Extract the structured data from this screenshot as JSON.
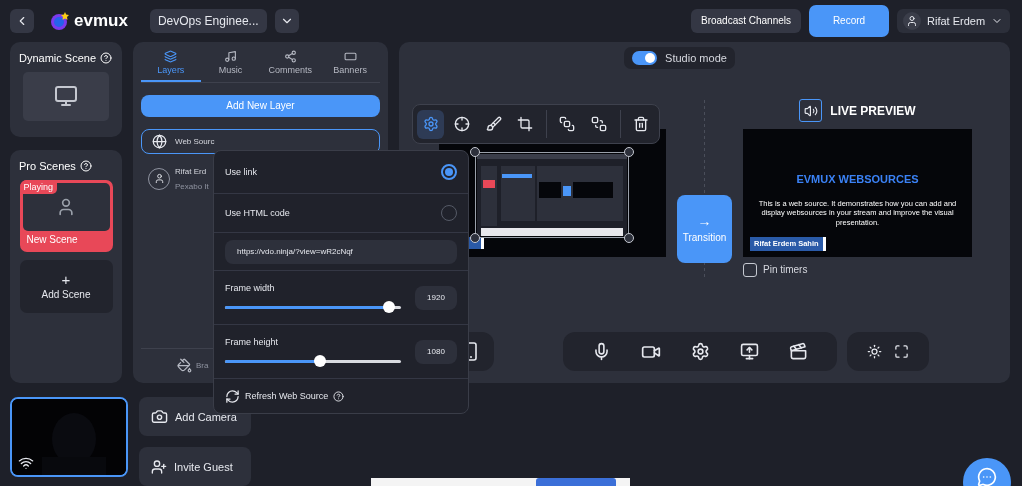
{
  "header": {
    "brand": "evmux",
    "project": "DevOps Enginee...",
    "buttons": [
      {
        "label": "Broadcast Channels",
        "kind": "secondary"
      },
      {
        "label": "Record",
        "kind": "primary"
      }
    ],
    "user": "Rifat Erdem"
  },
  "dynamic_scene": {
    "title": "Dynamic Scene"
  },
  "pro_scenes": {
    "title": "Pro Scenes",
    "scenes": [
      {
        "name": "New Scene",
        "badge": "Playing",
        "selected": true
      }
    ],
    "add_label": "Add Scene",
    "add_symbol": "+"
  },
  "layers_panel": {
    "tabs": [
      {
        "label": "Layers",
        "kind": "layers",
        "selected": true
      },
      {
        "label": "Music",
        "kind": "music",
        "selected": false
      },
      {
        "label": "Comments",
        "kind": "comments",
        "selected": false
      },
      {
        "label": "Banners",
        "kind": "banners",
        "selected": false
      }
    ],
    "add_button": "Add New Layer",
    "layers": [
      {
        "name": "Web Sourc",
        "kind": "web",
        "selected": true
      },
      {
        "name": "Rifat Erd",
        "subtitle": "Pexabo It",
        "kind": "person",
        "selected": false
      }
    ],
    "footer": "Bra"
  },
  "source_popup": {
    "options": [
      {
        "label": "Use link",
        "selected": true
      },
      {
        "label": "Use HTML code",
        "selected": false
      }
    ],
    "url": "https://vdo.ninja/?view=wR2cNqf",
    "sliders": [
      {
        "label": "Frame width",
        "level": 0.93,
        "value": "1920"
      },
      {
        "label": "Frame height",
        "level": 0.54,
        "value": "1080"
      }
    ],
    "refresh": "Refresh Web Source"
  },
  "stage": {
    "studio_mode": {
      "label": "Studio mode",
      "on": true
    },
    "transition": {
      "arrow": "→",
      "label": "Transition"
    },
    "live_preview": {
      "title": "LIVE PREVIEW",
      "headline": "EVMUX WEBSOURCES",
      "text": "This is a web source. It demonstrates how you can add and display websources in your stream and improve the visual presentation.",
      "name_tag": "Rifat Erdem Sahin"
    },
    "pin_timers": {
      "label": "Pin timers",
      "checked": false
    }
  },
  "bottom": {
    "add_camera": "Add Camera",
    "invite_guest": "Invite Guest"
  }
}
